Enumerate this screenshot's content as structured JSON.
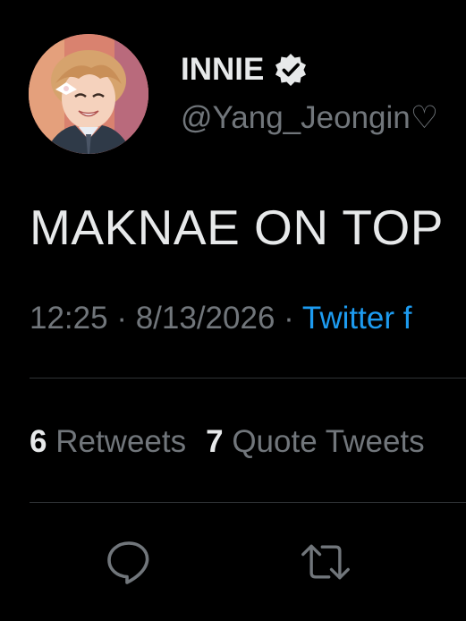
{
  "tweet": {
    "author": {
      "display_name": "INNIE",
      "handle": "@Yang_Jeongin♡",
      "verified": true,
      "avatar_icon": "profile-photo"
    },
    "text": "MAKNAE ON TOP",
    "meta": {
      "time": "12:25",
      "separator": " · ",
      "date": "8/13/2026",
      "source": "Twitter f"
    },
    "stats": {
      "retweets_count": "6",
      "retweets_label": "Retweets",
      "quotes_count": "7",
      "quotes_label": "Quote Tweets"
    },
    "actions": [
      {
        "icon": "reply-icon"
      },
      {
        "icon": "retweet-icon"
      }
    ]
  },
  "colors": {
    "background": "#000000",
    "primary_text": "#e7e9ea",
    "secondary_text": "#71767b",
    "link": "#1d9bf0",
    "divider": "#2f3336"
  }
}
